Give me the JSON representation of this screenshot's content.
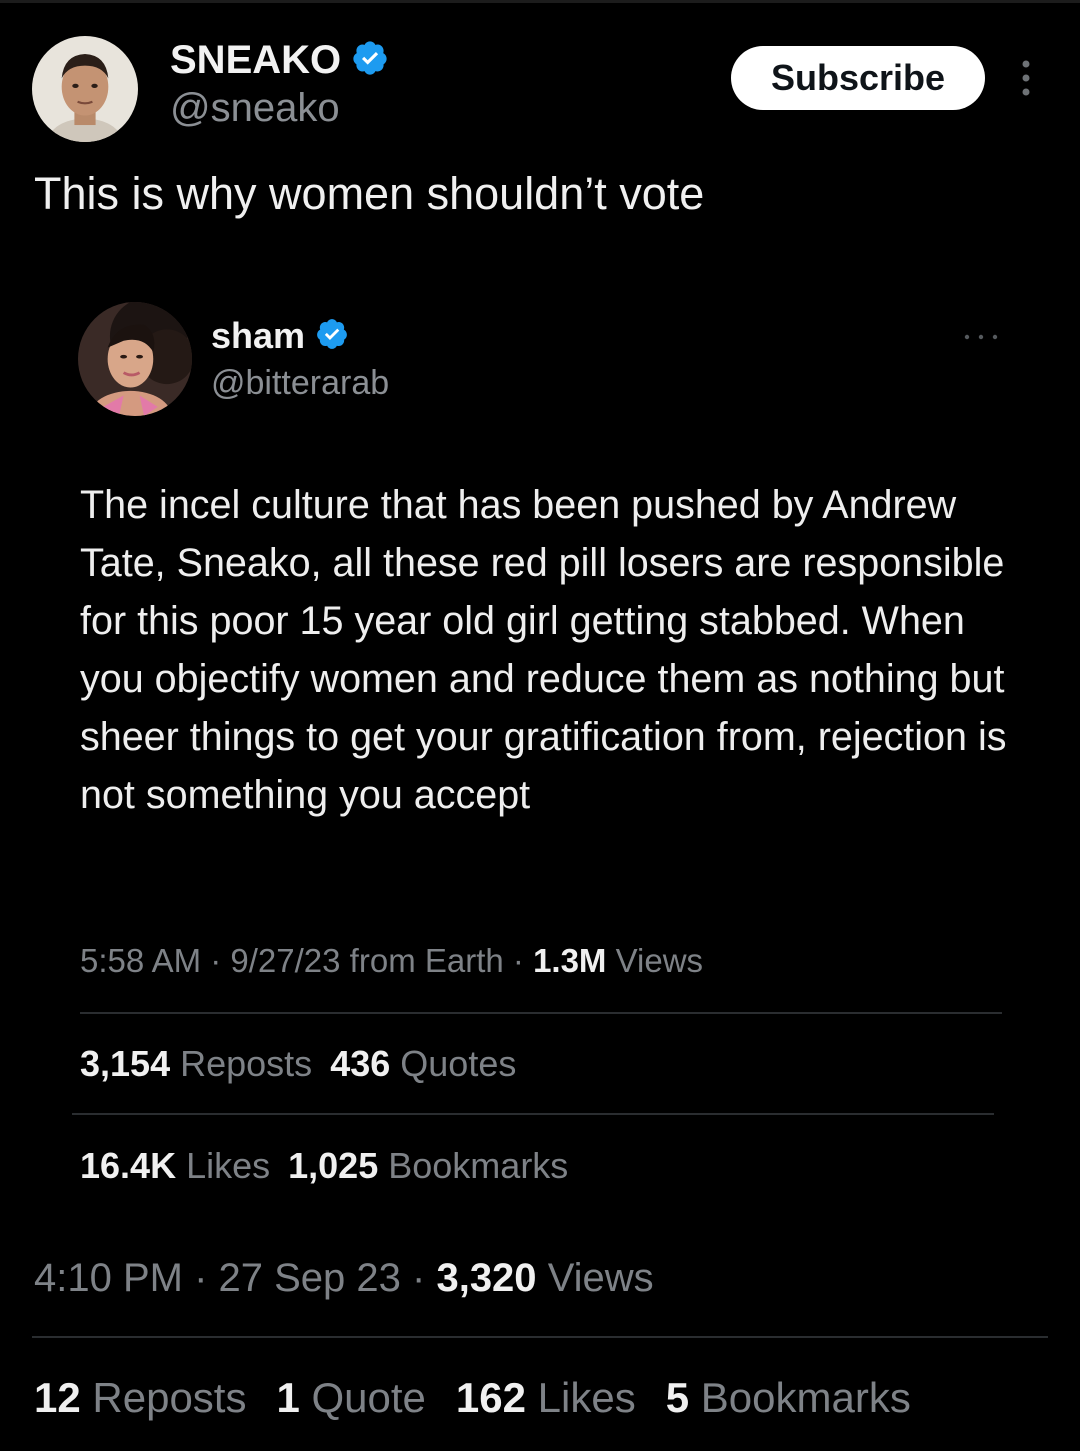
{
  "author": {
    "name": "SNEAKO",
    "handle": "@sneako",
    "verified": true
  },
  "subscribe_label": "Subscribe",
  "tweet_text": "This is why women shouldn’t vote",
  "quoted": {
    "name": "sham",
    "handle": "@bitterarab",
    "verified": true,
    "body": "The incel culture that has been pushed by Andrew Tate, Sneako, all these red pill losers are responsible for this poor 15 year old girl getting stabbed. When you objectify women and reduce them as nothing but sheer things to get your gratification from, rejection is not something you accept",
    "meta": {
      "time": "5:58 AM",
      "date": "9/27/23 from Earth",
      "views_count": "1.3M",
      "views_label": "Views"
    },
    "stats": {
      "reposts_count": "3,154",
      "reposts_label": "Reposts",
      "quotes_count": "436",
      "quotes_label": "Quotes",
      "likes_count": "16.4K",
      "likes_label": "Likes",
      "bookmarks_count": "1,025",
      "bookmarks_label": "Bookmarks"
    }
  },
  "meta": {
    "time": "4:10 PM",
    "date": "27 Sep 23",
    "views_count": "3,320",
    "views_label": "Views"
  },
  "stats": {
    "reposts_count": "12",
    "reposts_label": "Reposts",
    "quotes_count": "1",
    "quotes_label": "Quote",
    "likes_count": "162",
    "likes_label": "Likes",
    "bookmarks_count": "5",
    "bookmarks_label": "Bookmarks"
  },
  "colors": {
    "background": "#000000",
    "verified_badge": "#1d9bf0",
    "muted_text": "#7e8287",
    "button_bg": "#ffffff"
  },
  "icons": {
    "verified": "verified-badge-icon",
    "more_main": "more-vertical-icon",
    "more_quoted": "more-horizontal-icon"
  }
}
